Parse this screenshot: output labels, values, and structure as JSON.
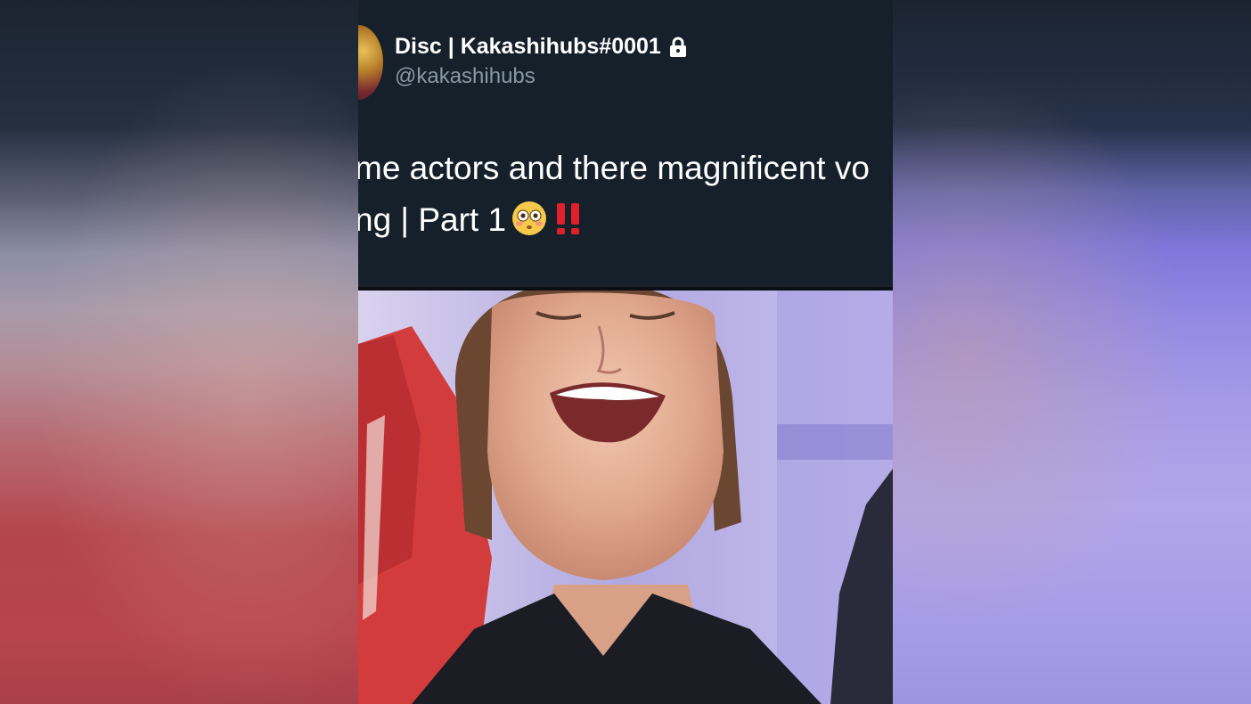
{
  "tweet": {
    "display_name": "Disc | Kakashihubs#0001",
    "handle": "@kakashihubs",
    "text_line_1": "me actors and there magnificent vo",
    "text_line_2": "ng | Part 1",
    "icons": {
      "lock": "lock-icon",
      "emoji_1": "flushed-face-emoji-icon",
      "emoji_2": "double-exclamation-emoji-icon"
    }
  },
  "colors": {
    "background": "#15202b",
    "text_primary": "#ffffff",
    "text_secondary": "#8899a6",
    "accent_red": "#e0202a"
  },
  "video": {
    "content": "video-frame-image"
  }
}
